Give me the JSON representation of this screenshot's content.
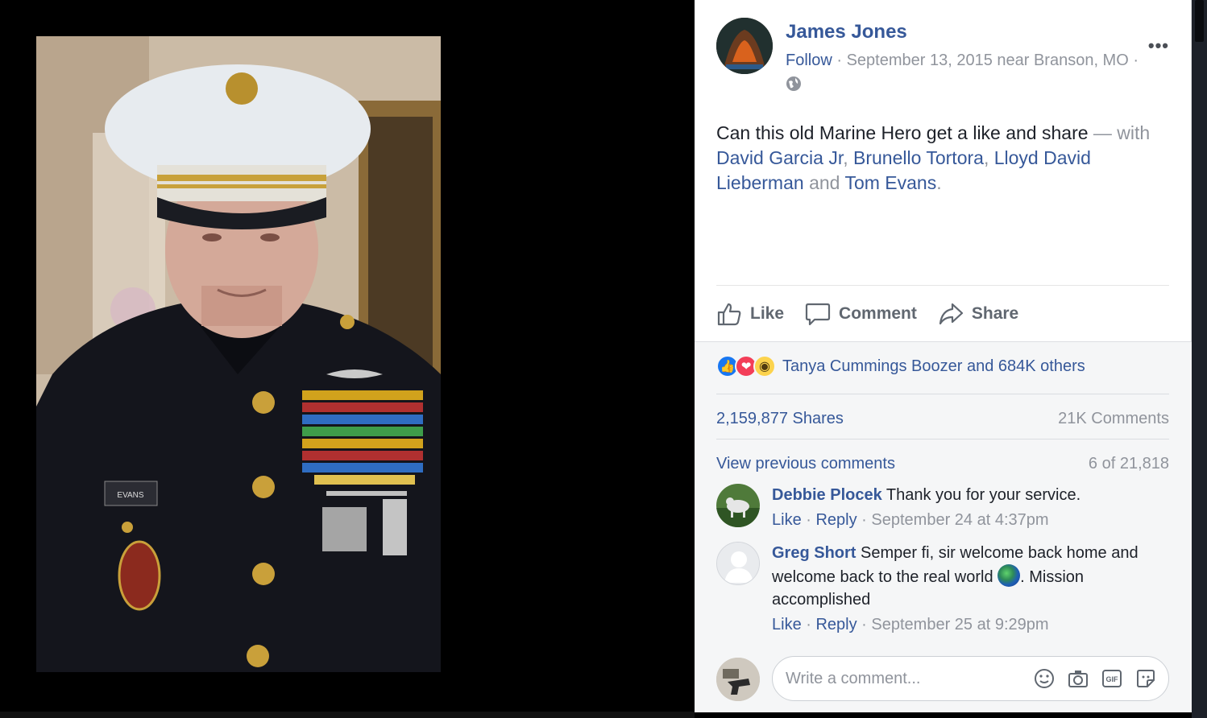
{
  "post": {
    "author": "James Jones",
    "follow_label": "Follow",
    "meta_text": " · September 13, 2015 near Branson, MO ·",
    "more_label": "•••",
    "text_main": "Can this old Marine Hero get a like and share",
    "text_with": " — with ",
    "tagged": [
      "David Garcia Jr",
      "Brunello Tortora",
      "Lloyd David Lieberman",
      "Tom Evans"
    ],
    "sep_comma": ", ",
    "sep_and": " and ",
    "period": "."
  },
  "actions": {
    "like": "Like",
    "comment": "Comment",
    "share": "Share"
  },
  "feedback": {
    "reactions_text": "Tanya Cummings Boozer and 684K others",
    "shares": "2,159,877 Shares",
    "comments_count": "21K Comments",
    "view_previous": "View previous comments",
    "count_of": "6 of 21,818"
  },
  "comments": [
    {
      "name": "Debbie Plocek",
      "text": " Thank you for your service.",
      "like": "Like",
      "reply": "Reply",
      "sep": " · ",
      "time": "September 24 at 4:37pm"
    },
    {
      "name": "Greg Short",
      "text": " Semper fi, sir welcome back home and welcome back to the real world ",
      "text_after": ". Mission accomplished",
      "like": "Like",
      "reply": "Reply",
      "sep": " · ",
      "time": "September 25 at 9:29pm"
    }
  ],
  "composer": {
    "placeholder": "Write a comment..."
  },
  "photo": {
    "nametag": "EVANS"
  },
  "colors": {
    "link": "#365899",
    "muted": "#90949c",
    "panel_bg": "#ffffff",
    "feedback_bg": "#f5f6f7"
  },
  "icons": [
    "like-icon",
    "comment-icon",
    "share-icon",
    "globe-icon",
    "emoji-icon",
    "camera-icon",
    "gif-icon",
    "sticker-icon"
  ]
}
